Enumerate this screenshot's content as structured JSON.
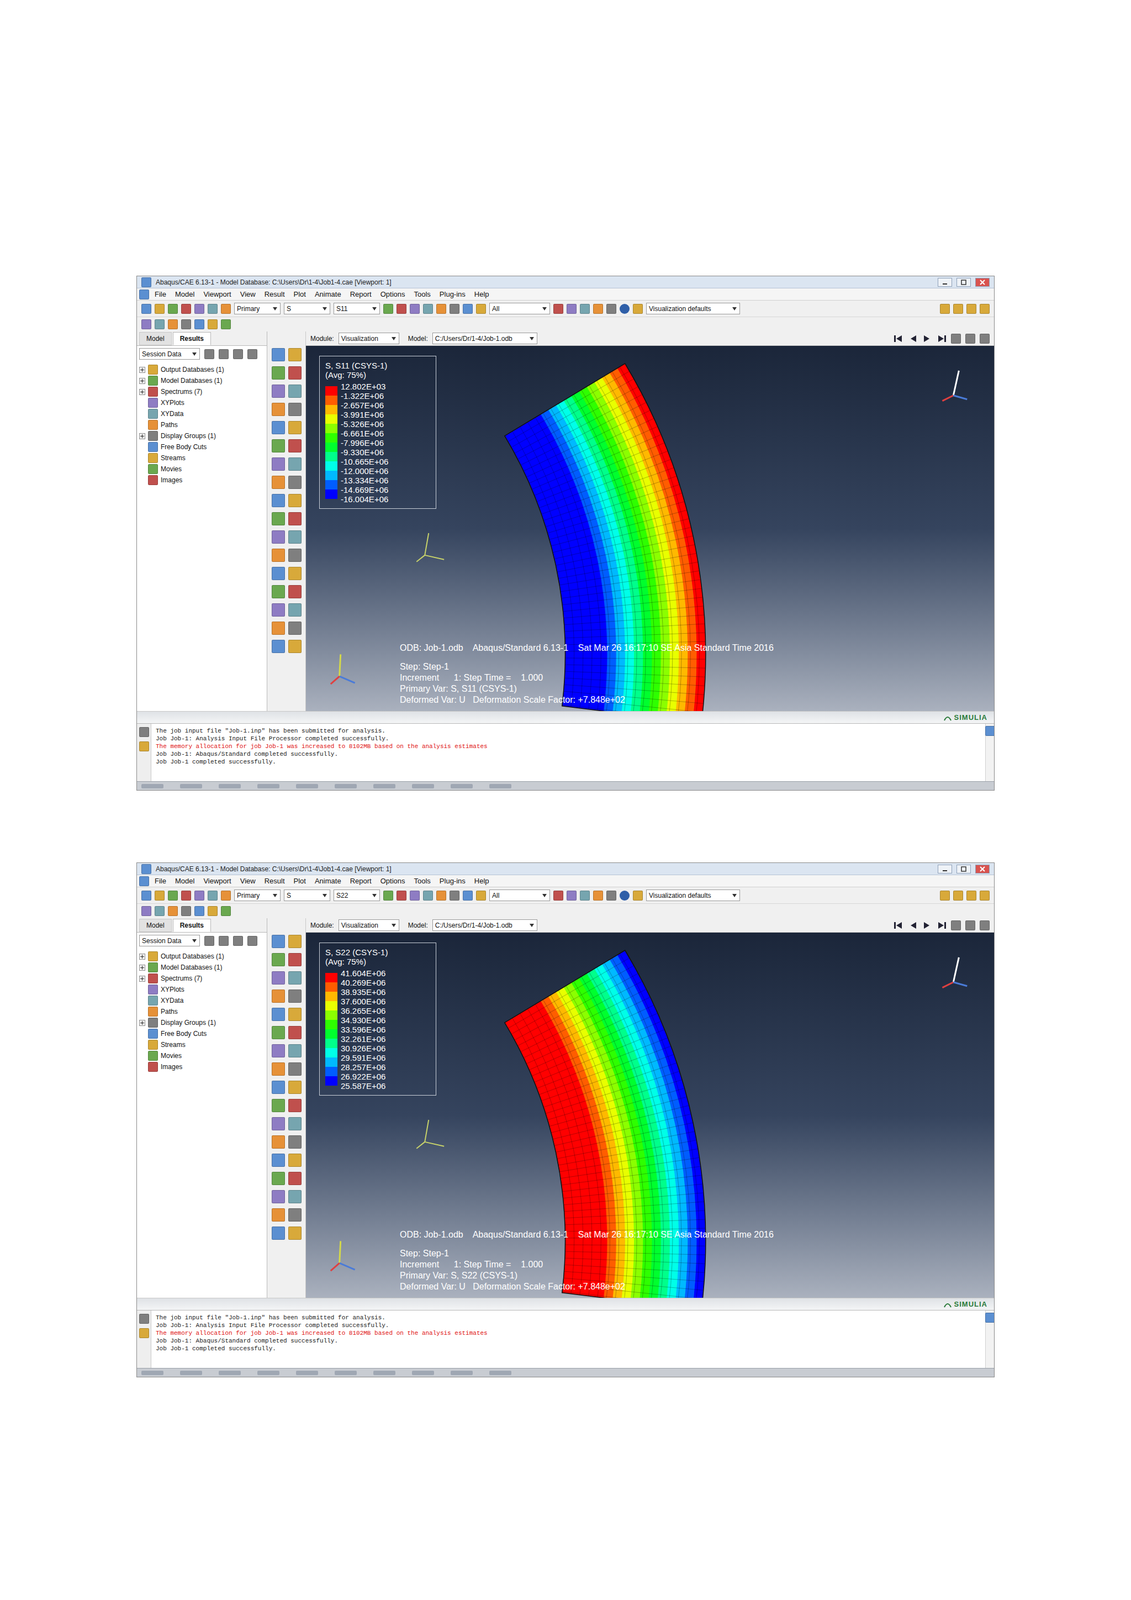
{
  "screenshots": [
    {
      "window": {
        "title": "Abaqus/CAE 6.13-1 - Model Database: C:\\Users\\Dr\\1-4\\Job1-4.cae [Viewport: 1]"
      },
      "menu": [
        "File",
        "Model",
        "Viewport",
        "View",
        "Result",
        "Plot",
        "Animate",
        "Report",
        "Options",
        "Tools",
        "Plug-ins",
        "Help"
      ],
      "toolbar": {
        "field": "Primary",
        "variable": "S",
        "component": "S11",
        "display": "All",
        "defaults": "Visualization defaults"
      },
      "panel_tabs": [
        {
          "label": "Model",
          "selected": false
        },
        {
          "label": "Results",
          "selected": true
        }
      ],
      "session": "Session Data",
      "tree": [
        {
          "label": "Output Databases (1)",
          "kind": "branch",
          "expanded": false
        },
        {
          "label": "Model Databases (1)",
          "kind": "branch",
          "expanded": false
        },
        {
          "label": "Spectrums (7)",
          "kind": "branch",
          "expanded": false
        },
        {
          "label": "XYPlots",
          "kind": "leaf",
          "expanded": false
        },
        {
          "label": "XYData",
          "kind": "leaf",
          "expanded": false
        },
        {
          "label": "Paths",
          "kind": "leaf",
          "expanded": false
        },
        {
          "label": "Display Groups (1)",
          "kind": "branch",
          "expanded": false
        },
        {
          "label": "Free Body Cuts",
          "kind": "leaf",
          "expanded": false
        },
        {
          "label": "Streams",
          "kind": "leaf",
          "expanded": false
        },
        {
          "label": "Movies",
          "kind": "leaf",
          "expanded": false
        },
        {
          "label": "Images",
          "kind": "leaf",
          "expanded": false
        }
      ],
      "module_bar": {
        "module_label": "Module:",
        "module": "Visualization",
        "model_label": "Model:",
        "model": "C:/Users/Dr/1-4/Job-1.odb"
      },
      "legend": {
        "title": "S, S11 (CSYS-1)",
        "avg": "(Avg: 75%)",
        "values": [
          "12.802E+03",
          "-1.322E+06",
          "-2.657E+06",
          "-3.991E+06",
          "-5.326E+06",
          "-6.661E+06",
          "-7.996E+06",
          "-9.330E+06",
          "-10.665E+06",
          "-12.000E+06",
          "-13.334E+06",
          "-14.669E+06",
          "-16.004E+06"
        ],
        "colors": [
          "#ff0000",
          "#ff5d00",
          "#ffb900",
          "#e8ff00",
          "#8bff00",
          "#2eff00",
          "#00ff2e",
          "#00ff8b",
          "#00ffe8",
          "#00b9ff",
          "#005dff",
          "#0000ff"
        ]
      },
      "contour": {
        "colors": [
          "#ff0000",
          "#ff5d00",
          "#ffb900",
          "#e8ff00",
          "#8bff00",
          "#2eff00",
          "#00ff2e",
          "#00ff8b",
          "#00ffe8",
          "#00b9ff",
          "#005dff",
          "#0000ff"
        ]
      },
      "info": [
        "ODB: Job-1.odb    Abaqus/Standard 6.13-1    Sat Mar 26 16:17:10 SE Asia Standard Time 2016",
        "Step: Step-1",
        "Increment      1: Step Time =    1.000",
        "Primary Var: S, S11 (CSYS-1)",
        "Deformed Var: U   Deformation Scale Factor: +7.848e+02"
      ],
      "brand": "SIMULIA",
      "messages": [
        {
          "text": "The job input file \"Job-1.inp\" has been submitted for analysis.",
          "color": "#202020"
        },
        {
          "text": "Job Job-1: Analysis Input File Processor completed successfully.",
          "color": "#202020"
        },
        {
          "text": "The memory allocation for job Job-1 was increased to 8102MB based on the analysis estimates",
          "color": "#e01010"
        },
        {
          "text": "Job Job-1: Abaqus/Standard completed successfully.",
          "color": "#202020"
        },
        {
          "text": "Job Job-1 completed successfully.",
          "color": "#202020"
        }
      ]
    },
    {
      "window": {
        "title": "Abaqus/CAE 6.13-1 - Model Database: C:\\Users\\Dr\\1-4\\Job1-4.cae [Viewport: 1]"
      },
      "menu": [
        "File",
        "Model",
        "Viewport",
        "View",
        "Result",
        "Plot",
        "Animate",
        "Report",
        "Options",
        "Tools",
        "Plug-ins",
        "Help"
      ],
      "toolbar": {
        "field": "Primary",
        "variable": "S",
        "component": "S22",
        "display": "All",
        "defaults": "Visualization defaults"
      },
      "panel_tabs": [
        {
          "label": "Model",
          "selected": false
        },
        {
          "label": "Results",
          "selected": true
        }
      ],
      "session": "Session Data",
      "tree": [
        {
          "label": "Output Databases (1)",
          "kind": "branch",
          "expanded": false
        },
        {
          "label": "Model Databases (1)",
          "kind": "branch",
          "expanded": false
        },
        {
          "label": "Spectrums (7)",
          "kind": "branch",
          "expanded": false
        },
        {
          "label": "XYPlots",
          "kind": "leaf",
          "expanded": false
        },
        {
          "label": "XYData",
          "kind": "leaf",
          "expanded": false
        },
        {
          "label": "Paths",
          "kind": "leaf",
          "expanded": false
        },
        {
          "label": "Display Groups (1)",
          "kind": "branch",
          "expanded": false
        },
        {
          "label": "Free Body Cuts",
          "kind": "leaf",
          "expanded": false
        },
        {
          "label": "Streams",
          "kind": "leaf",
          "expanded": false
        },
        {
          "label": "Movies",
          "kind": "leaf",
          "expanded": false
        },
        {
          "label": "Images",
          "kind": "leaf",
          "expanded": false
        }
      ],
      "module_bar": {
        "module_label": "Module:",
        "module": "Visualization",
        "model_label": "Model:",
        "model": "C:/Users/Dr/1-4/Job-1.odb"
      },
      "legend": {
        "title": "S, S22 (CSYS-1)",
        "avg": "(Avg: 75%)",
        "values": [
          "41.604E+06",
          "40.269E+06",
          "38.935E+06",
          "37.600E+06",
          "36.265E+06",
          "34.930E+06",
          "33.596E+06",
          "32.261E+06",
          "30.926E+06",
          "29.591E+06",
          "28.257E+06",
          "26.922E+06",
          "25.587E+06"
        ],
        "colors": [
          "#ff0000",
          "#ff5d00",
          "#ffb900",
          "#e8ff00",
          "#8bff00",
          "#2eff00",
          "#00ff2e",
          "#00ff8b",
          "#00ffe8",
          "#00b9ff",
          "#005dff",
          "#0000ff"
        ]
      },
      "contour": {
        "colors": [
          "#0000ff",
          "#005dff",
          "#00b9ff",
          "#00ffe8",
          "#00ff8b",
          "#00ff2e",
          "#2eff00",
          "#8bff00",
          "#e8ff00",
          "#ffb900",
          "#ff5d00",
          "#ff0000"
        ]
      },
      "info": [
        "ODB: Job-1.odb    Abaqus/Standard 6.13-1    Sat Mar 26 16:17:10 SE Asia Standard Time 2016",
        "Step: Step-1",
        "Increment      1: Step Time =    1.000",
        "Primary Var: S, S22 (CSYS-1)",
        "Deformed Var: U   Deformation Scale Factor: +7.848e+02"
      ],
      "brand": "SIMULIA",
      "messages": [
        {
          "text": "The job input file \"Job-1.inp\" has been submitted for analysis.",
          "color": "#202020"
        },
        {
          "text": "Job Job-1: Analysis Input File Processor completed successfully.",
          "color": "#202020"
        },
        {
          "text": "The memory allocation for job Job-1 was increased to 8102MB based on the analysis estimates",
          "color": "#e01010"
        },
        {
          "text": "Job Job-1: Abaqus/Standard completed successfully.",
          "color": "#202020"
        },
        {
          "text": "Job Job-1 completed successfully.",
          "color": "#202020"
        }
      ]
    }
  ]
}
